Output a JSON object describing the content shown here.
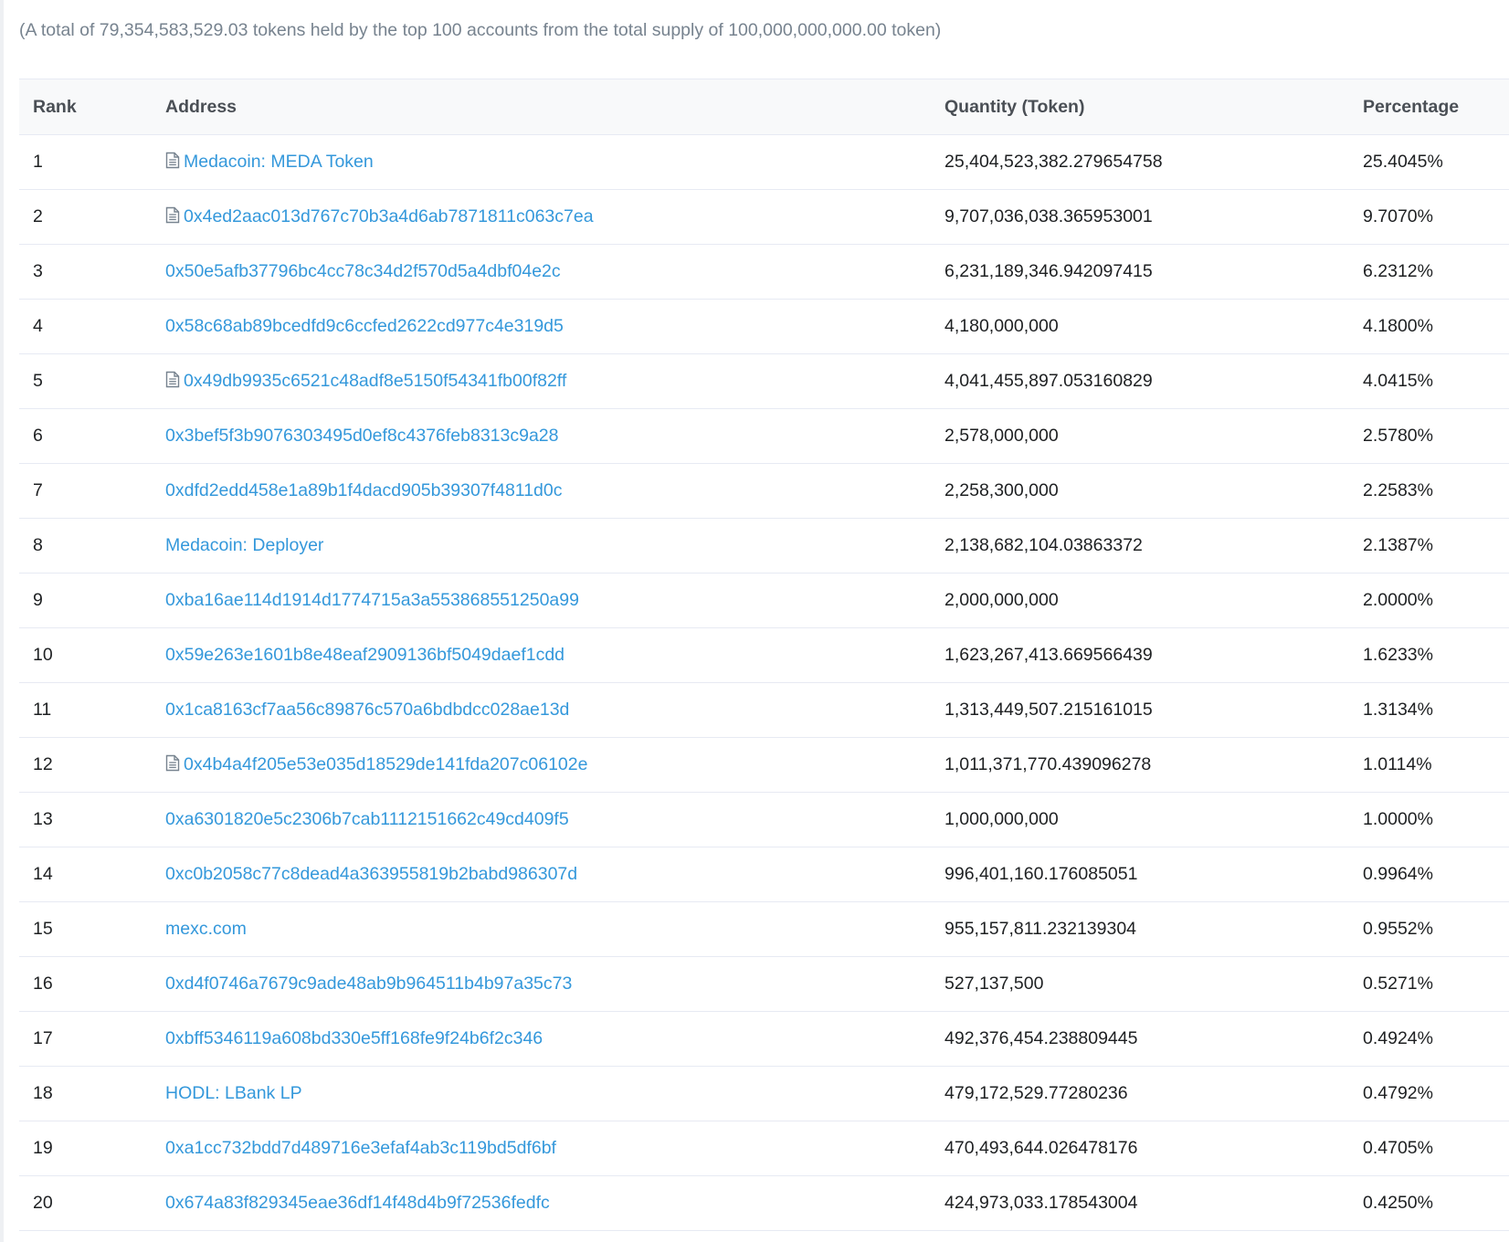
{
  "summary": "(A total of 79,354,583,529.03 tokens held by the top 100 accounts from the total supply of 100,000,000,000.00 token)",
  "table": {
    "headers": {
      "rank": "Rank",
      "address": "Address",
      "quantity": "Quantity (Token)",
      "percentage": "Percentage"
    },
    "rows": [
      {
        "rank": "1",
        "address": "Medacoin: MEDA Token",
        "contract": true,
        "quantity": "25,404,523,382.279654758",
        "percentage": "25.4045%"
      },
      {
        "rank": "2",
        "address": "0x4ed2aac013d767c70b3a4d6ab7871811c063c7ea",
        "contract": true,
        "quantity": "9,707,036,038.365953001",
        "percentage": "9.7070%"
      },
      {
        "rank": "3",
        "address": "0x50e5afb37796bc4cc78c34d2f570d5a4dbf04e2c",
        "contract": false,
        "quantity": "6,231,189,346.942097415",
        "percentage": "6.2312%"
      },
      {
        "rank": "4",
        "address": "0x58c68ab89bcedfd9c6ccfed2622cd977c4e319d5",
        "contract": false,
        "quantity": "4,180,000,000",
        "percentage": "4.1800%"
      },
      {
        "rank": "5",
        "address": "0x49db9935c6521c48adf8e5150f54341fb00f82ff",
        "contract": true,
        "quantity": "4,041,455,897.053160829",
        "percentage": "4.0415%"
      },
      {
        "rank": "6",
        "address": "0x3bef5f3b9076303495d0ef8c4376feb8313c9a28",
        "contract": false,
        "quantity": "2,578,000,000",
        "percentage": "2.5780%"
      },
      {
        "rank": "7",
        "address": "0xdfd2edd458e1a89b1f4dacd905b39307f4811d0c",
        "contract": false,
        "quantity": "2,258,300,000",
        "percentage": "2.2583%"
      },
      {
        "rank": "8",
        "address": "Medacoin: Deployer",
        "contract": false,
        "quantity": "2,138,682,104.03863372",
        "percentage": "2.1387%"
      },
      {
        "rank": "9",
        "address": "0xba16ae114d1914d1774715a3a553868551250a99",
        "contract": false,
        "quantity": "2,000,000,000",
        "percentage": "2.0000%"
      },
      {
        "rank": "10",
        "address": "0x59e263e1601b8e48eaf2909136bf5049daef1cdd",
        "contract": false,
        "quantity": "1,623,267,413.669566439",
        "percentage": "1.6233%"
      },
      {
        "rank": "11",
        "address": "0x1ca8163cf7aa56c89876c570a6bdbdcc028ae13d",
        "contract": false,
        "quantity": "1,313,449,507.215161015",
        "percentage": "1.3134%"
      },
      {
        "rank": "12",
        "address": "0x4b4a4f205e53e035d18529de141fda207c06102e",
        "contract": true,
        "quantity": "1,011,371,770.439096278",
        "percentage": "1.0114%"
      },
      {
        "rank": "13",
        "address": "0xa6301820e5c2306b7cab1112151662c49cd409f5",
        "contract": false,
        "quantity": "1,000,000,000",
        "percentage": "1.0000%"
      },
      {
        "rank": "14",
        "address": "0xc0b2058c77c8dead4a363955819b2babd986307d",
        "contract": false,
        "quantity": "996,401,160.176085051",
        "percentage": "0.9964%"
      },
      {
        "rank": "15",
        "address": "mexc.com",
        "contract": false,
        "quantity": "955,157,811.232139304",
        "percentage": "0.9552%"
      },
      {
        "rank": "16",
        "address": "0xd4f0746a7679c9ade48ab9b964511b4b97a35c73",
        "contract": false,
        "quantity": "527,137,500",
        "percentage": "0.5271%"
      },
      {
        "rank": "17",
        "address": "0xbff5346119a608bd330e5ff168fe9f24b6f2c346",
        "contract": false,
        "quantity": "492,376,454.238809445",
        "percentage": "0.4924%"
      },
      {
        "rank": "18",
        "address": "HODL: LBank LP",
        "contract": false,
        "quantity": "479,172,529.77280236",
        "percentage": "0.4792%"
      },
      {
        "rank": "19",
        "address": "0xa1cc732bdd7d489716e3efaf4ab3c119bd5df6bf",
        "contract": false,
        "quantity": "470,493,644.026478176",
        "percentage": "0.4705%"
      },
      {
        "rank": "20",
        "address": "0x674a83f829345eae36df14f48d4b9f72536fedfc",
        "contract": false,
        "quantity": "424,973,033.178543004",
        "percentage": "0.4250%"
      }
    ]
  },
  "colors": {
    "link": "#3498db",
    "muted_text": "#77838f",
    "header_bg": "#f8f9fa",
    "border": "#e7eaf3"
  },
  "icons": {
    "contract": "file-contract-icon"
  }
}
